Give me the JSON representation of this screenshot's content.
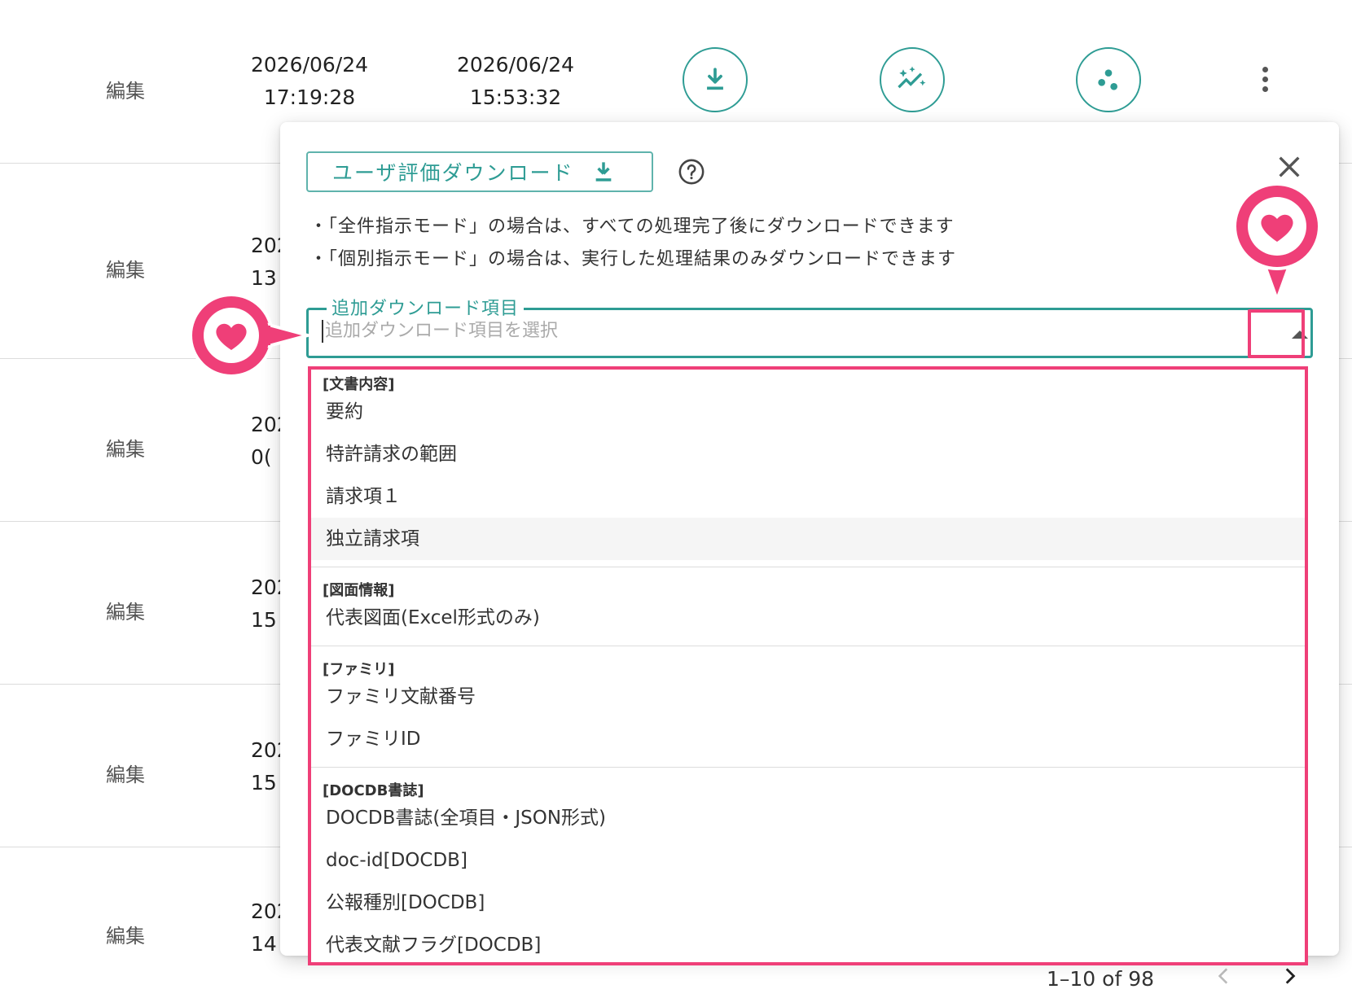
{
  "table": {
    "rows": [
      {
        "edit": "編集",
        "date1": "2026/06/24",
        "time1": "17:19:28",
        "date2": "2026/06/24",
        "time2": "15:53:32"
      },
      {
        "edit": "編集",
        "partial_date": "202",
        "partial_time": "13"
      },
      {
        "edit": "編集",
        "partial_date": "202",
        "partial_time": "0("
      },
      {
        "edit": "編集",
        "partial_date": "202",
        "partial_time": "15"
      },
      {
        "edit": "編集",
        "partial_date": "202",
        "partial_time": "15"
      },
      {
        "edit": "編集",
        "partial_date": "202",
        "partial_time": "14"
      }
    ],
    "actions": [
      "download-icon",
      "sparkle-chart-icon",
      "cluster-icon",
      "more-vert-icon"
    ]
  },
  "pagination": {
    "label": "1–10 of 98"
  },
  "popover": {
    "download_button_label": "ユーザ評価ダウンロード",
    "notes": [
      "・「全件指示モード」の場合は、すべての処理完了後にダウンロードできます",
      "・「個別指示モード」の場合は、実行した処理結果のみダウンロードできます"
    ],
    "field": {
      "legend": "追加ダウンロード項目",
      "placeholder": "追加ダウンロード項目を選択"
    },
    "groups": [
      {
        "header": "[文書内容]",
        "options": [
          "要約",
          "特許請求の範囲",
          "請求項１",
          "独立請求項"
        ],
        "hovered": "独立請求項"
      },
      {
        "header": "[図面情報]",
        "options": [
          "代表図面(Excel形式のみ)"
        ]
      },
      {
        "header": "[ファミリ]",
        "options": [
          "ファミリ文献番号",
          "ファミリID"
        ]
      },
      {
        "header": "[DOCDB書誌]",
        "options": [
          "DOCDB書誌(全項目・JSON形式)",
          "doc-id[DOCDB]",
          "公報種別[DOCDB]",
          "代表文献フラグ[DOCDB]"
        ]
      }
    ]
  },
  "colors": {
    "teal": "#2e9c94",
    "pink": "#ef3f78"
  }
}
